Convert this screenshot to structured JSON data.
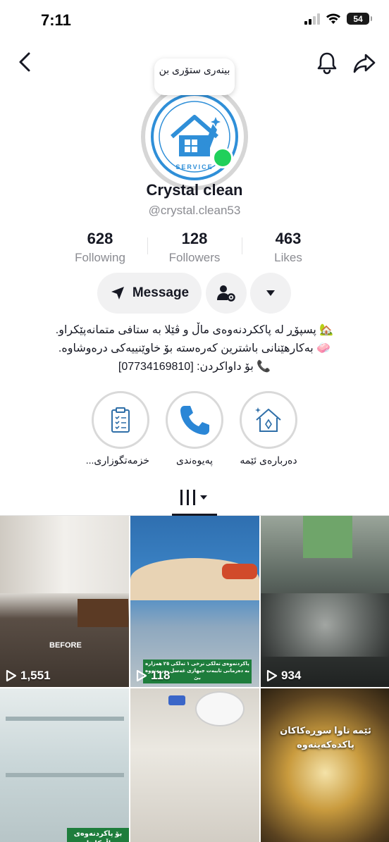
{
  "status_bar": {
    "time": "7:11",
    "battery": "54"
  },
  "story_bubble": {
    "text": "بینەری ستۆری بن"
  },
  "profile": {
    "display_name": "Crystal clean",
    "handle": "@crystal.clean53",
    "avatar_logo_text": "CRYSTAL CLEAN SERVICE"
  },
  "stats": [
    {
      "value": "628",
      "label": "Following"
    },
    {
      "value": "128",
      "label": "Followers"
    },
    {
      "value": "463",
      "label": "Likes"
    }
  ],
  "actions": {
    "message_label": "Message"
  },
  "bio": {
    "line1": "🏡 پسپۆڕ لە پاککردنەوەی ماڵ و ڤێلا بە ستافی متمانەپێکراو.",
    "line2": "🧼 بەکارهێنانی باشترین کەرەستە بۆ خاوێنییەکی درەوشاوە.",
    "line3": "📞 بۆ داواکردن: [07734169810]"
  },
  "highlights": [
    {
      "label": "خزمەتگوزاری...",
      "icon": "clipboard-icon"
    },
    {
      "label": "پەیوەندی",
      "icon": "phone-icon"
    },
    {
      "label": "دەربارەی ئێمە",
      "icon": "house-icon"
    }
  ],
  "videos": [
    {
      "views": "1,551",
      "overlay": "BEFORE"
    },
    {
      "views": "118",
      "overlay_line1": "پاکردنەوەی تەلکی نرخی ١ تەلکی ٢٥ هەزارە",
      "overlay_line2": "بە دەرمانی تایبەت جیهازی غەسل بەرپەنەوە بێ"
    },
    {
      "views": "934"
    },
    {
      "views": "",
      "overlay": "بۆ پاکردنەوەی ماڵەکانتان"
    },
    {
      "views": ""
    },
    {
      "views": "",
      "overlay_line1": "ئێمە تاوا سوڕەکاکان",
      "overlay_line2": "پاکدەکەینەوە"
    }
  ],
  "colors": {
    "online": "#20d05b",
    "brand_blue": "#2f8fd8",
    "text_primary": "#161823",
    "text_secondary": "#8a8b91"
  }
}
